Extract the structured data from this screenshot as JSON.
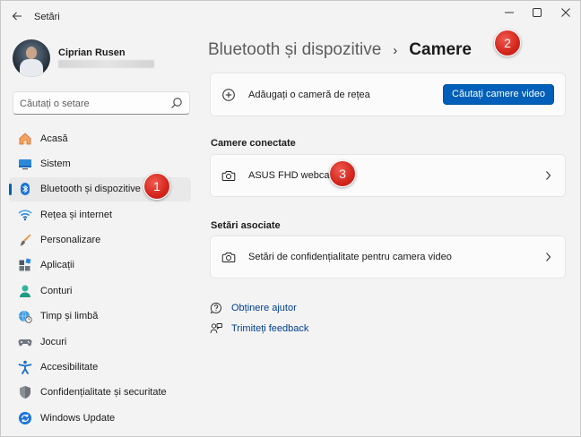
{
  "window": {
    "title": "Setări"
  },
  "user": {
    "name": "Ciprian Rusen"
  },
  "search": {
    "placeholder": "Căutați o setare"
  },
  "sidebar": {
    "items": [
      {
        "label": "Acasă",
        "icon": "home-icon",
        "selected": false
      },
      {
        "label": "Sistem",
        "icon": "system-icon",
        "selected": false
      },
      {
        "label": "Bluetooth și dispozitive",
        "icon": "bluetooth-icon",
        "selected": true
      },
      {
        "label": "Rețea și internet",
        "icon": "wifi-icon",
        "selected": false
      },
      {
        "label": "Personalizare",
        "icon": "brush-icon",
        "selected": false
      },
      {
        "label": "Aplicații",
        "icon": "apps-icon",
        "selected": false
      },
      {
        "label": "Conturi",
        "icon": "account-icon",
        "selected": false
      },
      {
        "label": "Timp și limbă",
        "icon": "globe-clock-icon",
        "selected": false
      },
      {
        "label": "Jocuri",
        "icon": "gamepad-icon",
        "selected": false
      },
      {
        "label": "Accesibilitate",
        "icon": "accessibility-icon",
        "selected": false
      },
      {
        "label": "Confidențialitate și securitate",
        "icon": "shield-icon",
        "selected": false
      },
      {
        "label": "Windows Update",
        "icon": "update-icon",
        "selected": false
      }
    ]
  },
  "breadcrumb": {
    "parent": "Bluetooth și dispozitive",
    "separator": "›",
    "current": "Camere"
  },
  "add_camera": {
    "label": "Adăugați o cameră de rețea",
    "button": "Căutați camere video"
  },
  "connected": {
    "title": "Camere conectate",
    "camera_name": "ASUS FHD webcam"
  },
  "related": {
    "title": "Setări asociate",
    "privacy_label": "Setări de confidențialitate pentru camera video"
  },
  "links": {
    "help": "Obținere ajutor",
    "feedback": "Trimiteți feedback"
  },
  "badges": [
    "1",
    "2",
    "3"
  ],
  "colors": {
    "accent": "#005fb8",
    "badge": "#d3251c",
    "link": "#003e92"
  }
}
